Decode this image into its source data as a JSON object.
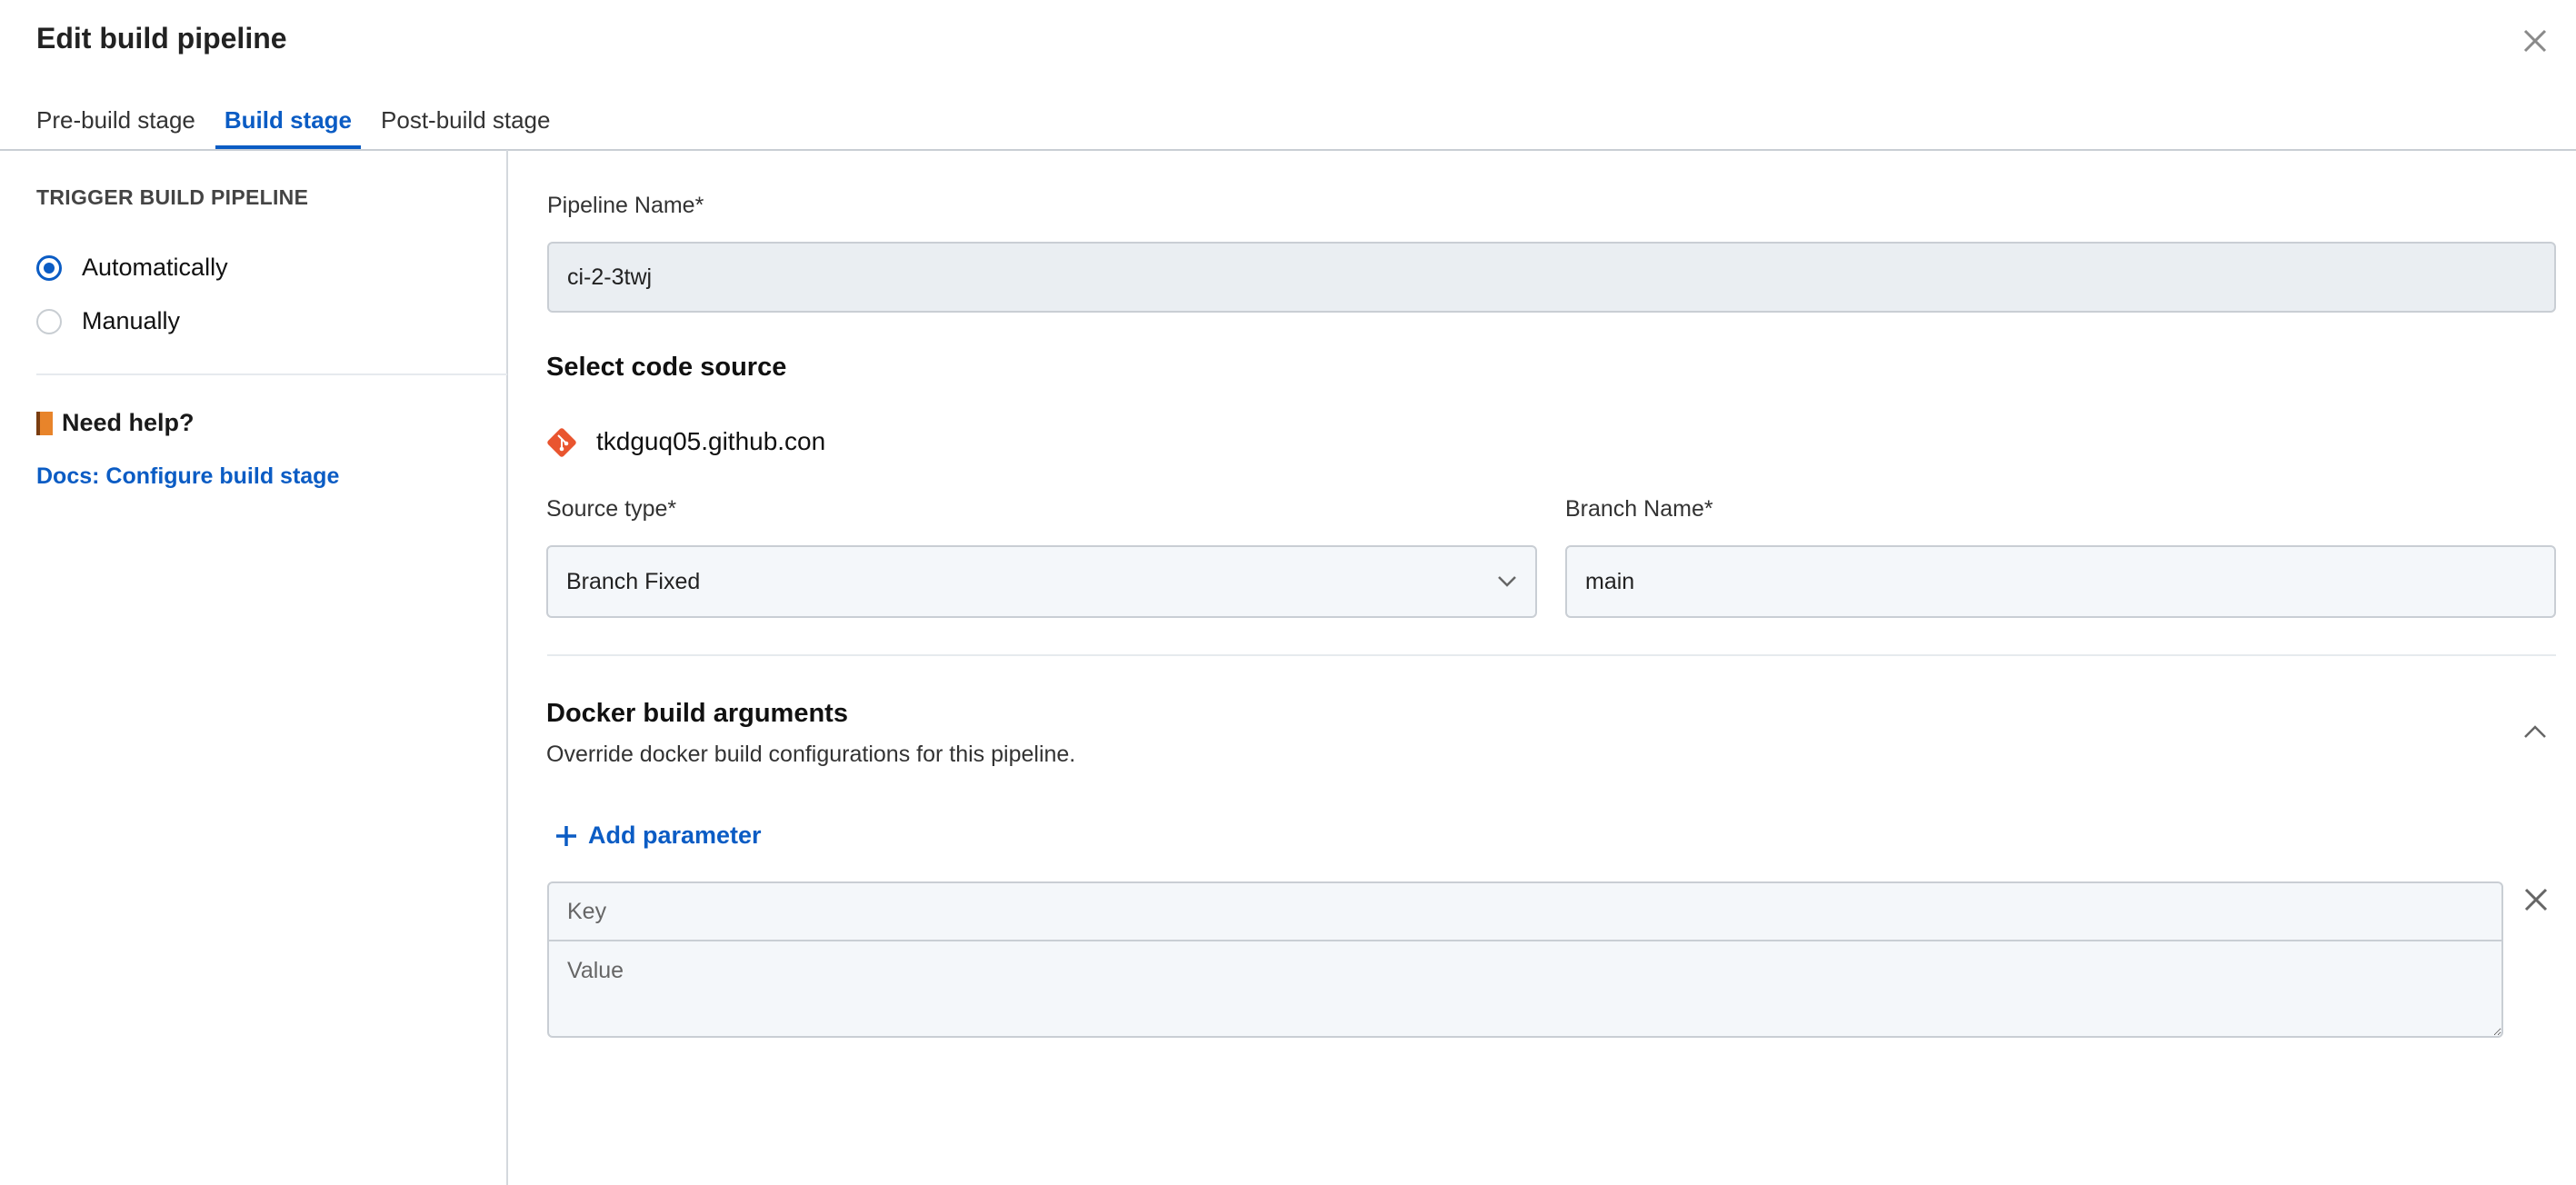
{
  "header": {
    "title": "Edit build pipeline",
    "close_icon": "close-icon"
  },
  "tabs": [
    {
      "label": "Pre-build stage",
      "active": false
    },
    {
      "label": "Build stage",
      "active": true
    },
    {
      "label": "Post-build stage",
      "active": false
    }
  ],
  "sidebar": {
    "trigger_heading": "TRIGGER BUILD PIPELINE",
    "options": [
      {
        "label": "Automatically",
        "selected": true
      },
      {
        "label": "Manually",
        "selected": false
      }
    ],
    "help_title": "Need help?",
    "help_icon": "book-icon",
    "docs_link": "Docs: Configure build stage"
  },
  "main": {
    "pipeline_name_label": "Pipeline Name*",
    "pipeline_name_value": "ci-2-3twj",
    "code_source_heading": "Select code source",
    "repo_icon": "git-icon",
    "repo_name": "tkdguq05.github.con",
    "source_type_label": "Source type*",
    "source_type_value": "Branch Fixed",
    "branch_name_label": "Branch Name*",
    "branch_name_value": "main",
    "docker_heading": "Docker build arguments",
    "docker_subtitle": "Override docker build configurations for this pipeline.",
    "add_parameter_label": "Add parameter",
    "key_placeholder": "Key",
    "value_placeholder": "Value"
  },
  "colors": {
    "accent": "#0b5cc4",
    "git": "#e9552f"
  }
}
